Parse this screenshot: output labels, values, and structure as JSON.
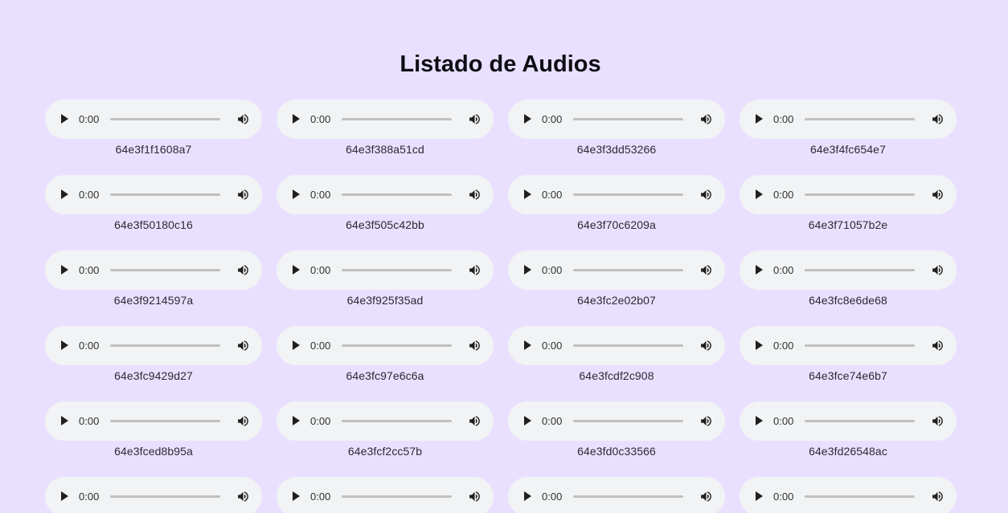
{
  "page": {
    "title": "Listado de Audios"
  },
  "colors": {
    "background": "#e9e0ff",
    "player_background": "#f1f3f4",
    "progress_track": "#c0c0c0"
  },
  "icons": {
    "play": "play-icon",
    "volume": "volume-icon"
  },
  "audios": [
    {
      "id": "64e3f1f1608a7",
      "time": "0:00"
    },
    {
      "id": "64e3f388a51cd",
      "time": "0:00"
    },
    {
      "id": "64e3f3dd53266",
      "time": "0:00"
    },
    {
      "id": "64e3f4fc654e7",
      "time": "0:00"
    },
    {
      "id": "64e3f50180c16",
      "time": "0:00"
    },
    {
      "id": "64e3f505c42bb",
      "time": "0:00"
    },
    {
      "id": "64e3f70c6209a",
      "time": "0:00"
    },
    {
      "id": "64e3f71057b2e",
      "time": "0:00"
    },
    {
      "id": "64e3f9214597a",
      "time": "0:00"
    },
    {
      "id": "64e3f925f35ad",
      "time": "0:00"
    },
    {
      "id": "64e3fc2e02b07",
      "time": "0:00"
    },
    {
      "id": "64e3fc8e6de68",
      "time": "0:00"
    },
    {
      "id": "64e3fc9429d27",
      "time": "0:00"
    },
    {
      "id": "64e3fc97e6c6a",
      "time": "0:00"
    },
    {
      "id": "64e3fcdf2c908",
      "time": "0:00"
    },
    {
      "id": "64e3fce74e6b7",
      "time": "0:00"
    },
    {
      "id": "64e3fced8b95a",
      "time": "0:00"
    },
    {
      "id": "64e3fcf2cc57b",
      "time": "0:00"
    },
    {
      "id": "64e3fd0c33566",
      "time": "0:00"
    },
    {
      "id": "64e3fd26548ac",
      "time": "0:00"
    },
    {
      "id": "",
      "time": "0:00"
    },
    {
      "id": "",
      "time": "0:00"
    },
    {
      "id": "",
      "time": "0:00"
    },
    {
      "id": "",
      "time": "0:00"
    }
  ]
}
